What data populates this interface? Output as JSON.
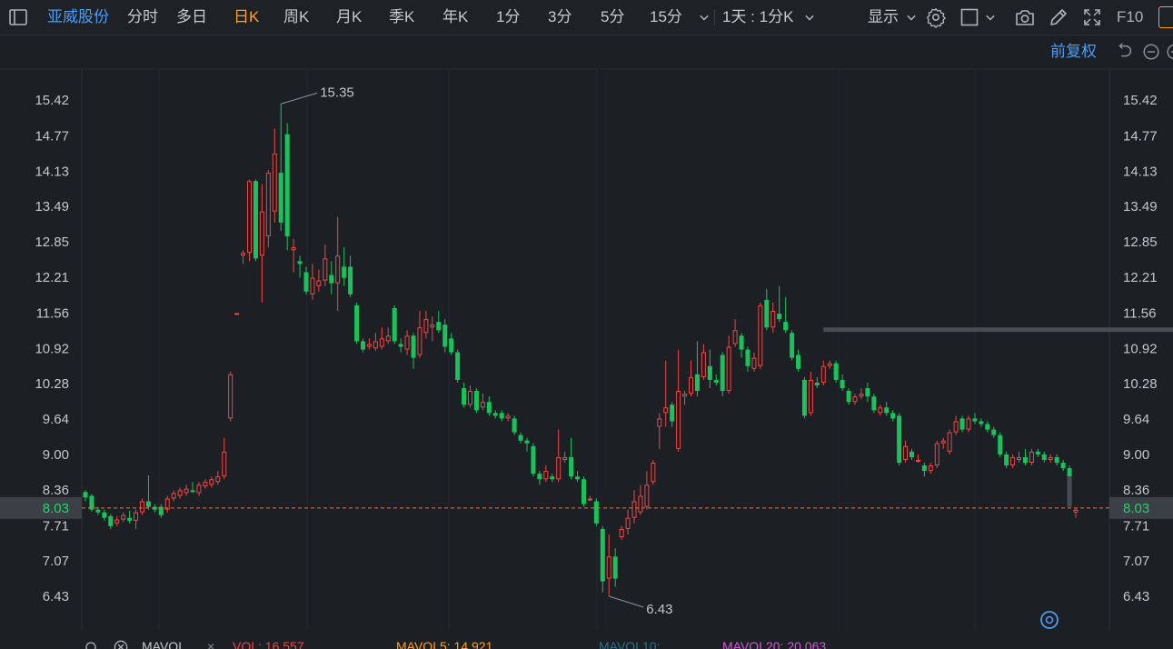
{
  "toolbar": {
    "stock_name": "亚威股份",
    "periods": [
      "分时",
      "多日",
      "日K",
      "周K",
      "月K",
      "季K",
      "年K",
      "1分",
      "3分",
      "5分",
      "15分"
    ],
    "active_period": "日K",
    "interval_label": "1天 : 1分K",
    "display_label": "显示",
    "f10_label": "F10"
  },
  "subbar": {
    "adjust_label": "前复权"
  },
  "price_axis": {
    "ticks": [
      "15.42",
      "14.77",
      "14.13",
      "13.49",
      "12.85",
      "12.21",
      "11.56",
      "10.92",
      "10.28",
      "9.64",
      "9.00",
      "8.36",
      "7.71",
      "7.07",
      "6.43"
    ],
    "current_price": "8.03"
  },
  "annotations": {
    "high_label": "15.35",
    "low_label": "6.43"
  },
  "indicators": {
    "name": "MAVOL",
    "vol": "VOL: 16.557",
    "mavol5": "MAVOL5: 14.921",
    "mavol10": "MAVOL10:",
    "mavol20": "MAVOL20: 20.063"
  },
  "colors": {
    "up": "#f04646",
    "down": "#19c25b",
    "accent": "#ff9f1a",
    "link": "#4f9bf2"
  },
  "chart_data": {
    "type": "candlestick",
    "y_axis_ticks": [
      15.42,
      14.77,
      14.13,
      13.49,
      12.85,
      12.21,
      11.56,
      10.92,
      10.28,
      9.64,
      9.0,
      8.36,
      7.71,
      7.07,
      6.43
    ],
    "ylim": [
      6.2,
      15.7
    ],
    "current_price": 8.03,
    "max_price": 15.35,
    "min_price": 6.43,
    "candles": [
      {
        "o": 8.32,
        "c": 8.22,
        "h": 8.35,
        "l": 8.15
      },
      {
        "o": 8.25,
        "c": 8.0,
        "h": 8.28,
        "l": 7.96
      },
      {
        "o": 8.0,
        "c": 7.95,
        "h": 8.05,
        "l": 7.9
      },
      {
        "o": 7.95,
        "c": 7.85,
        "h": 8.0,
        "l": 7.8
      },
      {
        "o": 7.88,
        "c": 7.7,
        "h": 7.92,
        "l": 7.65
      },
      {
        "o": 7.75,
        "c": 7.82,
        "h": 7.88,
        "l": 7.7
      },
      {
        "o": 7.82,
        "c": 7.9,
        "h": 7.95,
        "l": 7.78
      },
      {
        "o": 7.85,
        "c": 7.8,
        "h": 7.98,
        "l": 7.75
      },
      {
        "o": 7.8,
        "c": 7.95,
        "h": 8.0,
        "l": 7.65
      },
      {
        "o": 7.95,
        "c": 8.15,
        "h": 8.2,
        "l": 7.9
      },
      {
        "o": 8.15,
        "c": 8.05,
        "h": 8.62,
        "l": 8.0
      },
      {
        "o": 8.05,
        "c": 8.0,
        "h": 8.1,
        "l": 7.95
      },
      {
        "o": 8.05,
        "c": 7.9,
        "h": 8.1,
        "l": 7.85
      },
      {
        "o": 8.0,
        "c": 8.2,
        "h": 8.25,
        "l": 7.95
      },
      {
        "o": 8.2,
        "c": 8.3,
        "h": 8.35,
        "l": 8.15
      },
      {
        "o": 8.25,
        "c": 8.35,
        "h": 8.4,
        "l": 8.2
      },
      {
        "o": 8.3,
        "c": 8.38,
        "h": 8.45,
        "l": 8.25
      },
      {
        "o": 8.35,
        "c": 8.32,
        "h": 8.5,
        "l": 8.3
      },
      {
        "o": 8.3,
        "c": 8.45,
        "h": 8.5,
        "l": 8.25
      },
      {
        "o": 8.42,
        "c": 8.5,
        "h": 8.55,
        "l": 8.38
      },
      {
        "o": 8.45,
        "c": 8.55,
        "h": 8.6,
        "l": 8.4
      },
      {
        "o": 8.5,
        "c": 8.6,
        "h": 8.7,
        "l": 8.45
      },
      {
        "o": 8.6,
        "c": 9.05,
        "h": 9.3,
        "l": 8.55
      },
      {
        "o": 9.65,
        "c": 10.45,
        "h": 10.5,
        "l": 9.6
      },
      {
        "o": 11.56,
        "c": 11.56,
        "h": 11.56,
        "l": 11.56
      },
      {
        "o": 12.6,
        "c": 12.65,
        "h": 12.7,
        "l": 12.45
      },
      {
        "o": 12.65,
        "c": 13.95,
        "h": 13.98,
        "l": 12.5
      },
      {
        "o": 13.95,
        "c": 12.55,
        "h": 13.98,
        "l": 12.5
      },
      {
        "o": 12.6,
        "c": 13.4,
        "h": 13.9,
        "l": 11.75
      },
      {
        "o": 12.95,
        "c": 14.1,
        "h": 14.15,
        "l": 12.75
      },
      {
        "o": 13.4,
        "c": 14.45,
        "h": 14.9,
        "l": 13.2
      },
      {
        "o": 14.1,
        "c": 13.2,
        "h": 15.35,
        "l": 13.05
      },
      {
        "o": 14.8,
        "c": 12.95,
        "h": 15.0,
        "l": 12.7
      },
      {
        "o": 12.7,
        "c": 12.75,
        "h": 12.9,
        "l": 12.3
      },
      {
        "o": 12.5,
        "c": 12.45,
        "h": 12.6,
        "l": 12.2
      },
      {
        "o": 12.3,
        "c": 11.95,
        "h": 12.4,
        "l": 11.9
      },
      {
        "o": 11.9,
        "c": 12.2,
        "h": 12.45,
        "l": 11.8
      },
      {
        "o": 12.05,
        "c": 12.15,
        "h": 12.35,
        "l": 11.95
      },
      {
        "o": 12.15,
        "c": 12.55,
        "h": 12.8,
        "l": 12.05
      },
      {
        "o": 12.25,
        "c": 12.1,
        "h": 12.5,
        "l": 11.9
      },
      {
        "o": 12.1,
        "c": 12.6,
        "h": 13.3,
        "l": 11.6
      },
      {
        "o": 12.4,
        "c": 12.2,
        "h": 12.75,
        "l": 12.05
      },
      {
        "o": 12.4,
        "c": 11.9,
        "h": 12.6,
        "l": 11.85
      },
      {
        "o": 11.7,
        "c": 11.05,
        "h": 11.75,
        "l": 11.0
      },
      {
        "o": 11.05,
        "c": 10.9,
        "h": 11.1,
        "l": 10.85
      },
      {
        "o": 10.95,
        "c": 11.0,
        "h": 11.1,
        "l": 10.9
      },
      {
        "o": 10.92,
        "c": 11.05,
        "h": 11.2,
        "l": 10.88
      },
      {
        "o": 10.95,
        "c": 11.1,
        "h": 11.3,
        "l": 10.9
      },
      {
        "o": 11.05,
        "c": 11.15,
        "h": 11.3,
        "l": 11.0
      },
      {
        "o": 11.65,
        "c": 11.05,
        "h": 11.7,
        "l": 11.0
      },
      {
        "o": 11.0,
        "c": 10.95,
        "h": 11.1,
        "l": 10.85
      },
      {
        "o": 10.9,
        "c": 11.15,
        "h": 11.25,
        "l": 10.8
      },
      {
        "o": 11.15,
        "c": 10.75,
        "h": 11.2,
        "l": 10.55
      },
      {
        "o": 10.8,
        "c": 11.3,
        "h": 11.6,
        "l": 10.75
      },
      {
        "o": 11.2,
        "c": 11.45,
        "h": 11.6,
        "l": 11.1
      },
      {
        "o": 11.3,
        "c": 11.35,
        "h": 11.5,
        "l": 11.05
      },
      {
        "o": 11.4,
        "c": 11.25,
        "h": 11.6,
        "l": 11.2
      },
      {
        "o": 11.35,
        "c": 10.95,
        "h": 11.45,
        "l": 10.85
      },
      {
        "o": 11.1,
        "c": 10.85,
        "h": 11.2,
        "l": 10.8
      },
      {
        "o": 10.85,
        "c": 10.35,
        "h": 10.9,
        "l": 10.3
      },
      {
        "o": 10.2,
        "c": 9.9,
        "h": 10.3,
        "l": 9.85
      },
      {
        "o": 9.9,
        "c": 10.15,
        "h": 10.25,
        "l": 9.85
      },
      {
        "o": 10.15,
        "c": 9.8,
        "h": 10.2,
        "l": 9.75
      },
      {
        "o": 9.85,
        "c": 9.95,
        "h": 10.1,
        "l": 9.8
      },
      {
        "o": 9.95,
        "c": 9.75,
        "h": 10.05,
        "l": 9.7
      },
      {
        "o": 9.75,
        "c": 9.7,
        "h": 9.8,
        "l": 9.65
      },
      {
        "o": 9.75,
        "c": 9.65,
        "h": 9.8,
        "l": 9.6
      },
      {
        "o": 9.65,
        "c": 9.7,
        "h": 9.75,
        "l": 9.6
      },
      {
        "o": 9.65,
        "c": 9.4,
        "h": 9.7,
        "l": 9.35
      },
      {
        "o": 9.35,
        "c": 9.25,
        "h": 9.4,
        "l": 9.2
      },
      {
        "o": 9.25,
        "c": 9.2,
        "h": 9.3,
        "l": 9.05
      },
      {
        "o": 9.15,
        "c": 8.65,
        "h": 9.2,
        "l": 8.6
      },
      {
        "o": 8.65,
        "c": 8.55,
        "h": 8.7,
        "l": 8.45
      },
      {
        "o": 8.55,
        "c": 8.7,
        "h": 8.8,
        "l": 8.5
      },
      {
        "o": 8.6,
        "c": 8.55,
        "h": 8.65,
        "l": 8.5
      },
      {
        "o": 8.55,
        "c": 8.95,
        "h": 9.45,
        "l": 8.5
      },
      {
        "o": 8.9,
        "c": 8.95,
        "h": 9.05,
        "l": 8.85
      },
      {
        "o": 8.95,
        "c": 8.6,
        "h": 9.3,
        "l": 8.55
      },
      {
        "o": 8.6,
        "c": 8.55,
        "h": 8.7,
        "l": 8.5
      },
      {
        "o": 8.55,
        "c": 8.1,
        "h": 8.6,
        "l": 8.05
      },
      {
        "o": 8.2,
        "c": 8.2,
        "h": 8.25,
        "l": 8.15
      },
      {
        "o": 8.15,
        "c": 7.75,
        "h": 8.2,
        "l": 7.7
      },
      {
        "o": 7.65,
        "c": 6.7,
        "h": 7.7,
        "l": 6.5
      },
      {
        "o": 6.75,
        "c": 7.15,
        "h": 7.55,
        "l": 6.43
      },
      {
        "o": 7.15,
        "c": 6.75,
        "h": 7.3,
        "l": 6.6
      },
      {
        "o": 7.5,
        "c": 7.65,
        "h": 7.7,
        "l": 7.45
      },
      {
        "o": 7.65,
        "c": 7.85,
        "h": 8.0,
        "l": 7.55
      },
      {
        "o": 7.85,
        "c": 8.15,
        "h": 8.35,
        "l": 7.75
      },
      {
        "o": 7.95,
        "c": 8.25,
        "h": 8.45,
        "l": 7.9
      },
      {
        "o": 8.05,
        "c": 8.45,
        "h": 8.7,
        "l": 8.0
      },
      {
        "o": 8.5,
        "c": 8.85,
        "h": 8.9,
        "l": 8.45
      },
      {
        "o": 9.5,
        "c": 9.65,
        "h": 9.75,
        "l": 9.1
      },
      {
        "o": 9.75,
        "c": 9.85,
        "h": 10.7,
        "l": 9.5
      },
      {
        "o": 9.9,
        "c": 9.6,
        "h": 9.95,
        "l": 9.5
      },
      {
        "o": 9.1,
        "c": 10.15,
        "h": 10.9,
        "l": 9.05
      },
      {
        "o": 10.05,
        "c": 10.1,
        "h": 10.15,
        "l": 9.9
      },
      {
        "o": 10.1,
        "c": 10.4,
        "h": 10.7,
        "l": 10.05
      },
      {
        "o": 10.45,
        "c": 10.15,
        "h": 11.05,
        "l": 10.05
      },
      {
        "o": 10.4,
        "c": 10.85,
        "h": 11.0,
        "l": 10.35
      },
      {
        "o": 10.6,
        "c": 10.35,
        "h": 10.9,
        "l": 10.2
      },
      {
        "o": 10.35,
        "c": 10.3,
        "h": 10.45,
        "l": 10.25
      },
      {
        "o": 10.8,
        "c": 10.15,
        "h": 10.85,
        "l": 10.05
      },
      {
        "o": 10.15,
        "c": 10.95,
        "h": 11.15,
        "l": 10.1
      },
      {
        "o": 11.0,
        "c": 11.25,
        "h": 11.45,
        "l": 10.95
      },
      {
        "o": 11.15,
        "c": 10.9,
        "h": 11.2,
        "l": 10.75
      },
      {
        "o": 10.9,
        "c": 10.6,
        "h": 10.95,
        "l": 10.5
      },
      {
        "o": 10.55,
        "c": 10.75,
        "h": 10.85,
        "l": 10.5
      },
      {
        "o": 10.6,
        "c": 11.7,
        "h": 11.75,
        "l": 10.55
      },
      {
        "o": 11.8,
        "c": 11.3,
        "h": 12.0,
        "l": 11.25
      },
      {
        "o": 11.3,
        "c": 11.6,
        "h": 11.75,
        "l": 11.2
      },
      {
        "o": 11.55,
        "c": 11.45,
        "h": 12.05,
        "l": 11.4
      },
      {
        "o": 11.4,
        "c": 11.25,
        "h": 11.85,
        "l": 11.2
      },
      {
        "o": 11.2,
        "c": 10.75,
        "h": 11.25,
        "l": 10.7
      },
      {
        "o": 10.8,
        "c": 10.55,
        "h": 10.9,
        "l": 10.5
      },
      {
        "o": 10.35,
        "c": 9.7,
        "h": 10.4,
        "l": 9.65
      },
      {
        "o": 9.75,
        "c": 10.35,
        "h": 10.5,
        "l": 9.7
      },
      {
        "o": 10.3,
        "c": 10.25,
        "h": 10.4,
        "l": 10.2
      },
      {
        "o": 10.3,
        "c": 10.6,
        "h": 10.7,
        "l": 10.25
      },
      {
        "o": 10.6,
        "c": 10.65,
        "h": 10.7,
        "l": 10.55
      },
      {
        "o": 10.65,
        "c": 10.35,
        "h": 10.7,
        "l": 10.3
      },
      {
        "o": 10.35,
        "c": 10.2,
        "h": 10.45,
        "l": 10.15
      },
      {
        "o": 10.15,
        "c": 9.95,
        "h": 10.2,
        "l": 9.9
      },
      {
        "o": 9.95,
        "c": 10.05,
        "h": 10.1,
        "l": 9.9
      },
      {
        "o": 10.05,
        "c": 10.1,
        "h": 10.2,
        "l": 10.0
      },
      {
        "o": 10.2,
        "c": 10.05,
        "h": 10.3,
        "l": 9.95
      },
      {
        "o": 10.05,
        "c": 9.8,
        "h": 10.1,
        "l": 9.75
      },
      {
        "o": 9.75,
        "c": 9.85,
        "h": 9.9,
        "l": 9.7
      },
      {
        "o": 9.85,
        "c": 9.75,
        "h": 9.95,
        "l": 9.7
      },
      {
        "o": 9.75,
        "c": 9.65,
        "h": 9.8,
        "l": 9.6
      },
      {
        "o": 9.7,
        "c": 8.85,
        "h": 9.75,
        "l": 8.8
      },
      {
        "o": 8.9,
        "c": 9.15,
        "h": 9.25,
        "l": 8.85
      },
      {
        "o": 9.05,
        "c": 8.95,
        "h": 9.1,
        "l": 8.9
      },
      {
        "o": 8.9,
        "c": 8.9,
        "h": 9.0,
        "l": 8.85
      },
      {
        "o": 8.8,
        "c": 8.7,
        "h": 8.85,
        "l": 8.6
      },
      {
        "o": 8.7,
        "c": 8.8,
        "h": 8.85,
        "l": 8.65
      },
      {
        "o": 8.8,
        "c": 9.2,
        "h": 9.25,
        "l": 8.75
      },
      {
        "o": 9.2,
        "c": 9.25,
        "h": 9.3,
        "l": 9.1
      },
      {
        "o": 9.05,
        "c": 9.4,
        "h": 9.45,
        "l": 9.0
      },
      {
        "o": 9.4,
        "c": 9.6,
        "h": 9.7,
        "l": 9.35
      },
      {
        "o": 9.65,
        "c": 9.45,
        "h": 9.7,
        "l": 9.4
      },
      {
        "o": 9.45,
        "c": 9.65,
        "h": 9.7,
        "l": 9.4
      },
      {
        "o": 9.65,
        "c": 9.6,
        "h": 9.75,
        "l": 9.55
      },
      {
        "o": 9.6,
        "c": 9.55,
        "h": 9.65,
        "l": 9.5
      },
      {
        "o": 9.55,
        "c": 9.45,
        "h": 9.6,
        "l": 9.4
      },
      {
        "o": 9.45,
        "c": 9.35,
        "h": 9.5,
        "l": 9.3
      },
      {
        "o": 9.35,
        "c": 9.0,
        "h": 9.4,
        "l": 8.95
      },
      {
        "o": 9.0,
        "c": 8.8,
        "h": 9.05,
        "l": 8.75
      },
      {
        "o": 8.8,
        "c": 8.95,
        "h": 9.0,
        "l": 8.75
      },
      {
        "o": 8.9,
        "c": 8.95,
        "h": 9.05,
        "l": 8.85
      },
      {
        "o": 8.95,
        "c": 8.85,
        "h": 9.1,
        "l": 8.8
      },
      {
        "o": 8.85,
        "c": 9.05,
        "h": 9.1,
        "l": 8.8
      },
      {
        "o": 9.05,
        "c": 9.0,
        "h": 9.1,
        "l": 8.95
      },
      {
        "o": 9.0,
        "c": 8.9,
        "h": 9.05,
        "l": 8.85
      },
      {
        "o": 8.9,
        "c": 8.95,
        "h": 9.0,
        "l": 8.85
      },
      {
        "o": 8.95,
        "c": 8.85,
        "h": 9.0,
        "l": 8.8
      },
      {
        "o": 8.85,
        "c": 8.75,
        "h": 8.9,
        "l": 8.7
      },
      {
        "o": 8.75,
        "c": 8.6,
        "h": 8.8,
        "l": 8.55
      },
      {
        "o": 7.95,
        "c": 8.0,
        "h": 8.02,
        "l": 7.85
      }
    ],
    "highlight_bar": {
      "price_from": 11.3,
      "price_to": 11.22,
      "from_index": 117,
      "to_index": 181
    },
    "gap_bar": {
      "from": 8.6,
      "to": 8.05
    }
  }
}
